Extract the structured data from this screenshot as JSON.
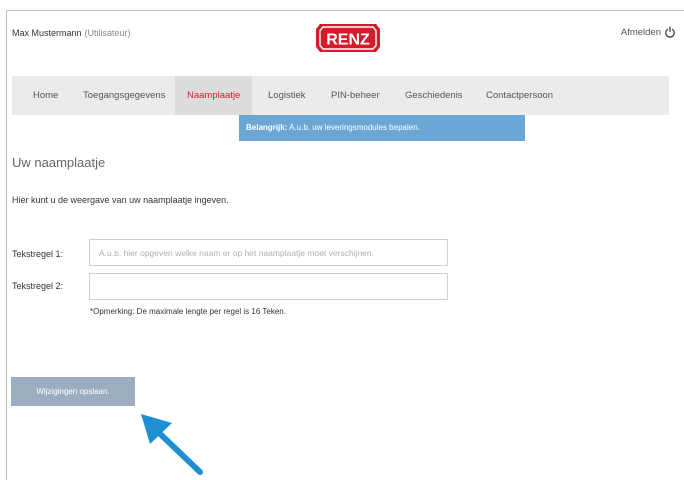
{
  "header": {
    "user_name": "Max Mustermann",
    "user_role": "(Utilisateur)",
    "logo_text": "RENZ",
    "logout_label": "Afmelden"
  },
  "nav": {
    "items": [
      {
        "label": "Home"
      },
      {
        "label": "Toegangsgegevens"
      },
      {
        "label": "Naamplaatje",
        "active": true
      },
      {
        "label": "Logistiek"
      },
      {
        "label": "PIN-beheer"
      },
      {
        "label": "Geschiedenis"
      },
      {
        "label": "Contactpersoon"
      }
    ]
  },
  "notice": {
    "strong": "Belangrijk:",
    "text": " A.u.b. uw leveringsmodules bepalen."
  },
  "main": {
    "title": "Uw naamplaatje",
    "intro": "Hier kunt u de weergave van uw naamplaatje ingeven.",
    "fields": [
      {
        "label": "Tekstregel 1:",
        "value": "",
        "placeholder": "A.u.b. hier opgeven welke naam er op het naamplaatje moet verschijnen."
      },
      {
        "label": "Tekstregel 2:",
        "value": "",
        "placeholder": ""
      }
    ],
    "note": "*Opmerking: De maximale lengte per regel is 16 Teken.",
    "save_label": "Wijzigingen opslaan."
  },
  "colors": {
    "brand_red": "#d41c2c",
    "notice_blue": "#6aa7d4",
    "button_grey_blue": "#9aaec0",
    "arrow_blue": "#1e8fd0"
  }
}
